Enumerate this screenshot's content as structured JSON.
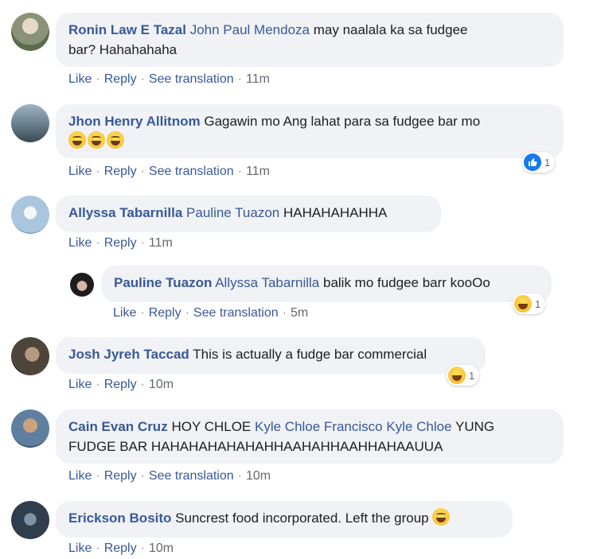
{
  "action_labels": {
    "like": "Like",
    "reply": "Reply",
    "translate": "See translation",
    "dot": "·"
  },
  "comments": [
    {
      "author": "Ronin Law E Tazal",
      "mention": "John Paul Mendoza",
      "text_line1": "may naalala ka sa fudgee",
      "text_line2": "bar? Hahahahaha",
      "time": "11m",
      "avatar_colors": [
        "#7e8a6a",
        "#d9d3c4"
      ]
    },
    {
      "author": "Jhon Henry Allitnom",
      "text": "Gagawin mo Ang lahat para sa fudgee bar mo",
      "emojis": [
        "laughing-emoji",
        "laughing-emoji",
        "laughing-emoji"
      ],
      "time": "11m",
      "reaction": {
        "icon": "like-icon",
        "count": "1"
      },
      "avatar_colors": [
        "#3c4f5a",
        "#8fa3b0"
      ]
    },
    {
      "author": "Allyssa Tabarnilla",
      "mention": "Pauline Tuazon",
      "text": "HAHAHAHAHHA",
      "time": "11m",
      "avatar_colors": [
        "#a8c3dc",
        "#e8eef4"
      ]
    },
    {
      "author": "Pauline Tuazon",
      "mention": "Allyssa Tabarnilla",
      "text": "balik mo fudgee barr kooOo",
      "time": "5m",
      "reaction": {
        "icon": "haha-icon",
        "count": "1"
      },
      "avatar_colors": [
        "#222222",
        "#c9a89a"
      ]
    },
    {
      "author": "Josh Jyreh Taccad",
      "text": "This is actually a fudge bar commercial",
      "time": "10m",
      "reaction": {
        "icon": "haha-icon",
        "count": "1"
      },
      "avatar_colors": [
        "#4b4238",
        "#b79e86"
      ]
    },
    {
      "author": "Cain Evan Cruz",
      "text_a": "HOY CHLOE",
      "mention": "Kyle Chloe Francisco Kyle Chloe",
      "text_b": "YUNG",
      "text_line2": "FUDGE BAR HAHAHAHAHAHAHHAAHAHHAAHHAHAAUUA",
      "time": "10m",
      "avatar_colors": [
        "#5a7a9c",
        "#c8a07a"
      ]
    },
    {
      "author": "Erickson Bosito",
      "text": "Suncrest food incorporated. Left the group",
      "emoji": "smiling-sweat-emoji",
      "time": "10m",
      "avatar_colors": [
        "#2d3a4a",
        "#7a8fa3"
      ]
    }
  ]
}
